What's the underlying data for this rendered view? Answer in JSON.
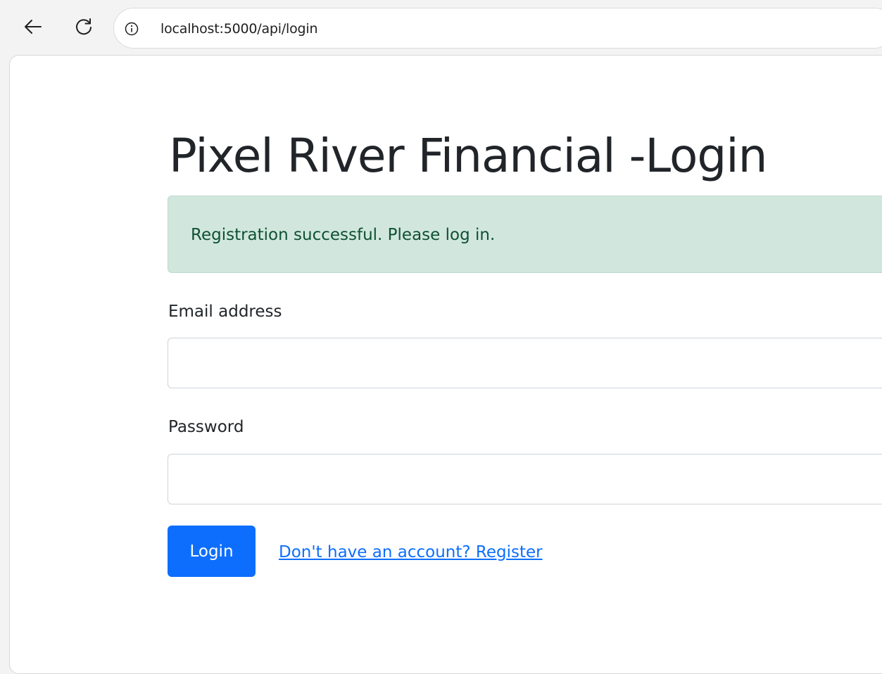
{
  "browser": {
    "url": "localhost:5000/api/login",
    "icons": {
      "back": "back-arrow-icon",
      "reload": "reload-icon",
      "info": "info-icon"
    }
  },
  "page": {
    "title": "Pixel River Financial -Login",
    "alert": {
      "text": "Registration successful. Please log in.",
      "background": "#d1e7dd",
      "color": "#0f5132"
    },
    "form": {
      "email_label": "Email address",
      "email_value": "",
      "password_label": "Password",
      "password_value": "",
      "login_label": "Login",
      "register_link": "Don't have an account? Register"
    },
    "colors": {
      "primary": "#0d6efd",
      "text": "#212529"
    }
  }
}
